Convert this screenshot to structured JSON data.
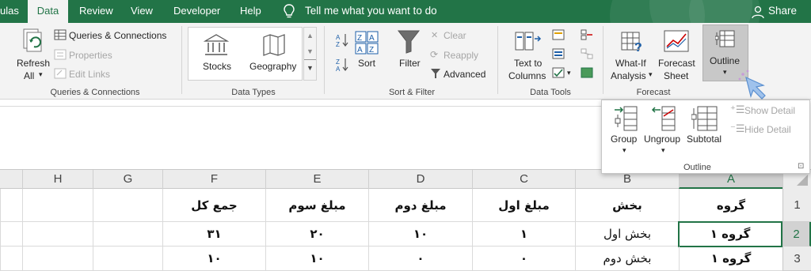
{
  "tabs": [
    {
      "label": "ulas",
      "active": false
    },
    {
      "label": "Data",
      "active": true
    },
    {
      "label": "Review",
      "active": false
    },
    {
      "label": "View",
      "active": false
    },
    {
      "label": "Developer",
      "active": false
    },
    {
      "label": "Help",
      "active": false
    }
  ],
  "tell_me": "Tell me what you want to do",
  "share": "Share",
  "groups": {
    "queries": {
      "label": "Queries & Connections",
      "refresh": [
        "Refresh",
        "All"
      ],
      "queries_connections": "Queries & Connections",
      "properties": "Properties",
      "edit_links": "Edit Links"
    },
    "data_types": {
      "label": "Data Types",
      "stocks": "Stocks",
      "geography": "Geography"
    },
    "sort_filter": {
      "label": "Sort & Filter",
      "sort": "Sort",
      "filter": "Filter",
      "clear": "Clear",
      "reapply": "Reapply",
      "advanced": "Advanced"
    },
    "data_tools": {
      "label": "Data Tools",
      "text_to_columns": [
        "Text to",
        "Columns"
      ]
    },
    "forecast": {
      "label": "Forecast",
      "what_if": [
        "What-If",
        "Analysis"
      ],
      "forecast_sheet": [
        "Forecast",
        "Sheet"
      ]
    },
    "outline": {
      "label": "Outline"
    }
  },
  "dropdown": {
    "group": "Group",
    "ungroup": "Ungroup",
    "subtotal": "Subtotal",
    "show_detail": "Show Detail",
    "hide_detail": "Hide Detail",
    "label": "Outline"
  },
  "columns": [
    "H",
    "G",
    "F",
    "E",
    "D",
    "C",
    "B",
    "A"
  ],
  "rows": [
    "1",
    "2",
    "3"
  ],
  "cells": {
    "row1": {
      "F": "جمع کل",
      "E": "مبلغ سوم",
      "D": "مبلغ دوم",
      "C": "مبلغ اول",
      "B": "بخش",
      "A": "گروه"
    },
    "row2": {
      "F": "۳۱",
      "E": "۲۰",
      "D": "۱۰",
      "C": "۱",
      "B": "بخش اول",
      "A": "گروه ۱"
    },
    "row3": {
      "F": "۱۰",
      "E": "۱۰",
      "D": "۰",
      "C": "۰",
      "B": "بخش دوم",
      "A": "گروه ۱"
    }
  },
  "colors": {
    "accent": "#217346",
    "tabbar": "#227447"
  }
}
